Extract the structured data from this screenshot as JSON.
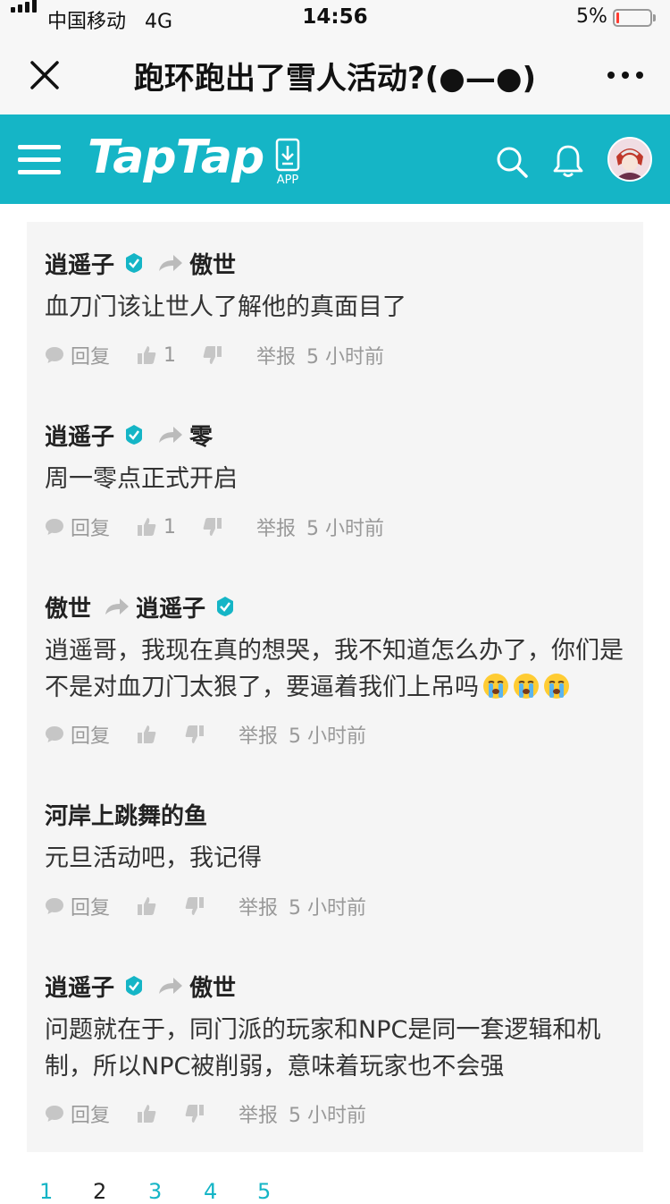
{
  "status_bar": {
    "carrier": "中国移动",
    "network": "4G",
    "time": "14:56",
    "battery": "5%"
  },
  "title_bar": {
    "title": "跑环跑出了雪人活动?(●—●)"
  },
  "app_header": {
    "logo": "TapTap",
    "app_label": "APP",
    "brand_color": "#15b5c6"
  },
  "comments": [
    {
      "author": "逍遥子",
      "reply_to": "傲世",
      "body": "血刀门该让世人了解他的真面目了",
      "reply_label": "回复",
      "likes": "1",
      "report": "举报",
      "time": "5 小时前"
    },
    {
      "author": "逍遥子",
      "reply_to": "零",
      "body": "周一零点正式开启",
      "reply_label": "回复",
      "likes": "1",
      "report": "举报",
      "time": "5 小时前"
    },
    {
      "author": "傲世",
      "reply_to": "逍遥子",
      "body": "逍遥哥，我现在真的想哭，我不知道怎么办了，你们是不是对血刀门太狠了，要逼着我们上吊吗",
      "reply_label": "回复",
      "likes": "",
      "report": "举报",
      "time": "5 小时前"
    },
    {
      "author": "河岸上跳舞的鱼",
      "body": "元旦活动吧，我记得",
      "reply_label": "回复",
      "likes": "",
      "report": "举报",
      "time": "5 小时前"
    },
    {
      "author": "逍遥子",
      "reply_to": "傲世",
      "body": "问题就在于，同门派的玩家和NPC是同一套逻辑和机制，所以NPC被削弱，意味着玩家也不会强",
      "reply_label": "回复",
      "likes": "",
      "report": "举报",
      "time": "5 小时前"
    }
  ],
  "pagination": [
    "1",
    "2",
    "3",
    "4",
    "5"
  ],
  "icons": [
    "close-icon",
    "more-icon",
    "menu-icon",
    "app-download-icon",
    "search-icon",
    "bell-icon",
    "verified-icon",
    "reply-arrow-icon",
    "comment-icon",
    "thumbs-up-icon",
    "thumbs-down-icon",
    "crying-emoji"
  ]
}
